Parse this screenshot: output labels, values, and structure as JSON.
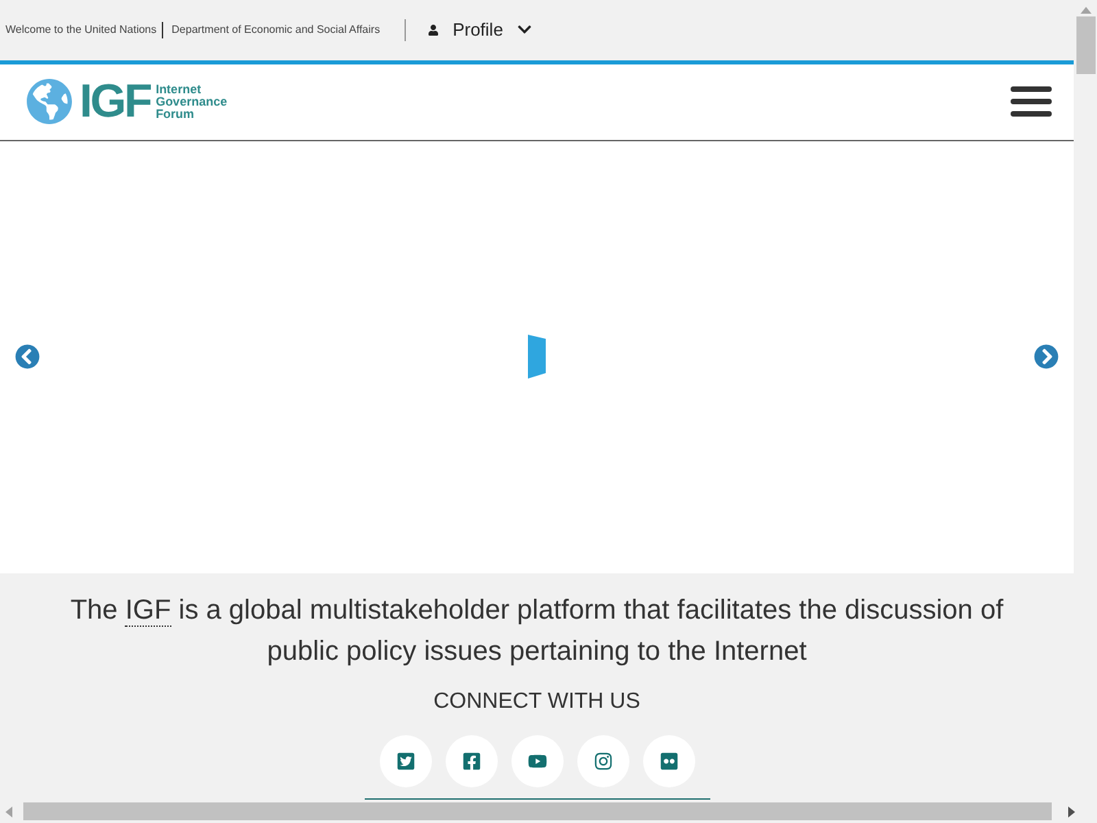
{
  "top_bar": {
    "links": [
      "Welcome to the United Nations",
      "Department of Economic and Social Affairs"
    ],
    "profile": "Profile"
  },
  "logo": {
    "mark": "IGF",
    "words": [
      "Internet",
      "Governance",
      "Forum"
    ]
  },
  "tagline": {
    "before": "The ",
    "abbr": "IGF",
    "after": " is a global multistakeholder platform that facilitates the discussion of public policy issues pertaining to the Internet"
  },
  "connect": {
    "title": "CONNECT WITH US",
    "social": [
      {
        "kind": "twitter"
      },
      {
        "kind": "facebook"
      },
      {
        "kind": "youtube"
      },
      {
        "kind": "instagram"
      },
      {
        "kind": "flickr"
      }
    ]
  }
}
